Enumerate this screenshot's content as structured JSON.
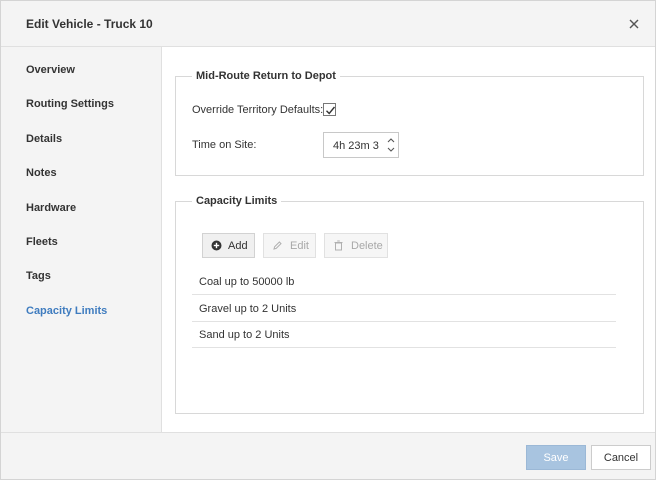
{
  "dialog": {
    "title": "Edit Vehicle - Truck 10",
    "close_icon": "close-icon"
  },
  "sidebar": {
    "items": [
      {
        "label": "Overview"
      },
      {
        "label": "Routing Settings"
      },
      {
        "label": "Details"
      },
      {
        "label": "Notes"
      },
      {
        "label": "Hardware"
      },
      {
        "label": "Fleets"
      },
      {
        "label": "Tags"
      },
      {
        "label": "Capacity Limits"
      }
    ],
    "active_item": "Capacity Limits"
  },
  "mid_route": {
    "legend": "Mid-Route Return to Depot",
    "override_label": "Override Territory Defaults:",
    "override_checked": true,
    "time_label": "Time on Site:",
    "time_value": "4h 23m 3"
  },
  "capacity": {
    "legend": "Capacity Limits",
    "toolbar": {
      "add_label": "Add",
      "edit_label": "Edit",
      "delete_label": "Delete"
    },
    "items": [
      {
        "text": "Coal up to 50000 lb"
      },
      {
        "text": "Gravel up to 2 Units"
      },
      {
        "text": "Sand up to 2 Units"
      }
    ]
  },
  "footer": {
    "save_label": "Save",
    "cancel_label": "Cancel"
  },
  "colors": {
    "accent": "#3f7cbf",
    "save_button": "#a8c4e0",
    "panel_bg": "#f4f4f4"
  }
}
